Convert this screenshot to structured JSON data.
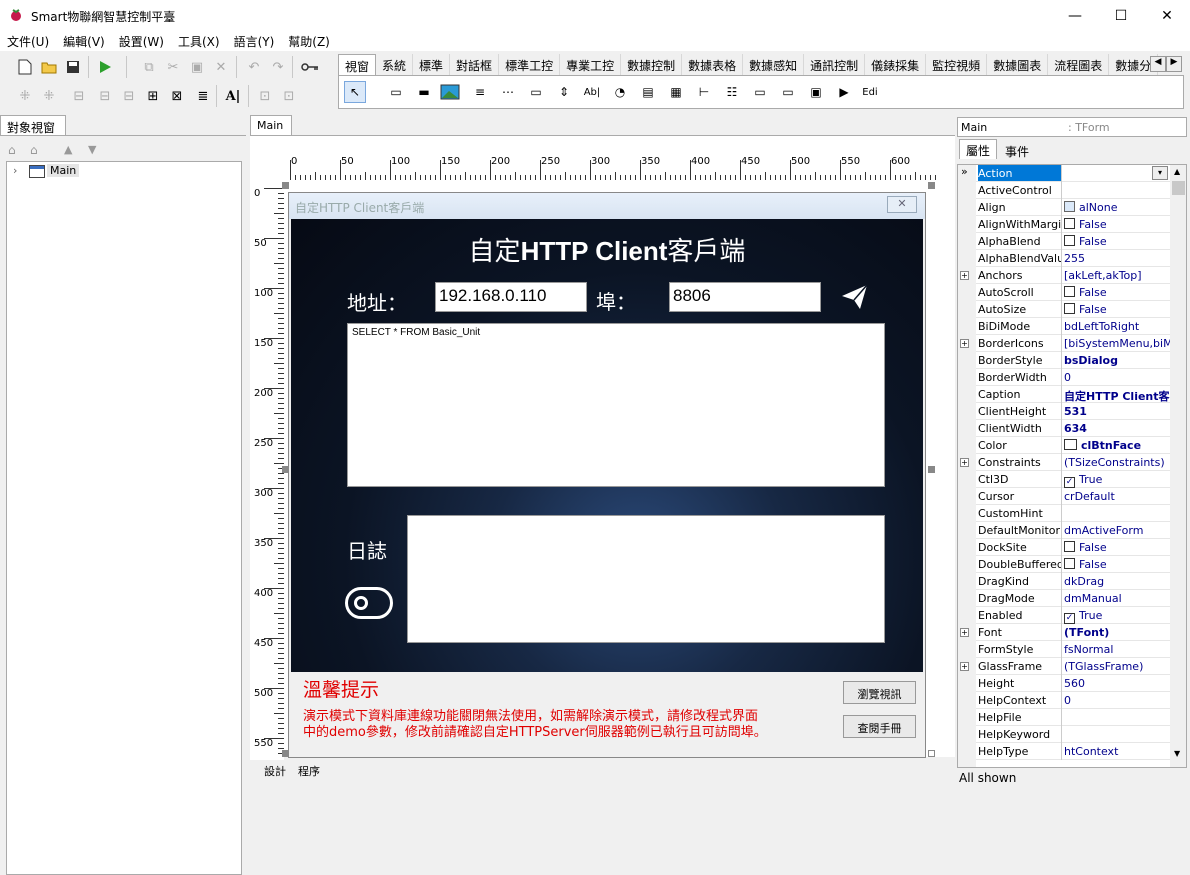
{
  "window": {
    "title": "Smart物聯網智慧控制平臺",
    "minimize": "—",
    "maximize": "☐",
    "close": "✕"
  },
  "menu": [
    "文件(U)",
    "編輯(V)",
    "設置(W)",
    "工具(X)",
    "語言(Y)",
    "幫助(Z)"
  ],
  "palette_tabs": [
    "視窗",
    "系統",
    "標準",
    "對話框",
    "標準工控",
    "專業工控",
    "數據控制",
    "數據表格",
    "數據感知",
    "通訊控制",
    "儀錶採集",
    "監控視頻",
    "數據圖表",
    "流程圖表",
    "數據分"
  ],
  "object_panel": {
    "title": "對象視窗",
    "tree_root": "Main"
  },
  "designer": {
    "tab": "Main",
    "bottom_tabs": [
      "設計",
      "程序"
    ],
    "hruler_labels": [
      "0",
      "50",
      "100",
      "150",
      "200",
      "250",
      "300",
      "350",
      "400",
      "450",
      "500",
      "550",
      "600"
    ],
    "vruler_labels": [
      "0",
      "50",
      "100",
      "150",
      "200",
      "250",
      "300",
      "350",
      "400",
      "450",
      "500",
      "550"
    ]
  },
  "form": {
    "window_title": "自定HTTP Client客戶端",
    "heading_prefix": "自定",
    "heading_bold": "HTTP Client",
    "heading_suffix": "客戶端",
    "address_label": "地址：",
    "address_value": "192.168.0.110",
    "port_label": "埠：",
    "port_value": "8806",
    "query_text": "SELECT * FROM Basic_Unit",
    "log_label": "日誌",
    "tip_title": "溫馨提示",
    "tip_line1": "演示模式下資料庫連線功能關閉無法使用，如需解除演示模式，請修改程式界面",
    "tip_line2": "中的demo參數，修改前請確認自定HTTPServer伺服器範例已執行且可訪問埠。",
    "browse_button": "瀏覽視訊",
    "manual_button": "查閱手冊"
  },
  "properties": {
    "object_name": "Main",
    "object_type": ": TForm",
    "tabs": [
      "屬性",
      "事件"
    ],
    "status": "All shown",
    "rows": [
      {
        "name": "Action",
        "value": "",
        "selected": true
      },
      {
        "name": "ActiveControl",
        "value": ""
      },
      {
        "name": "Align",
        "value": "alNone",
        "icon": "align"
      },
      {
        "name": "AlignWithMargins",
        "value": "False",
        "check": false
      },
      {
        "name": "AlphaBlend",
        "value": "False",
        "check": false
      },
      {
        "name": "AlphaBlendValue",
        "value": "255"
      },
      {
        "name": "Anchors",
        "value": "[akLeft,akTop]",
        "expand": true
      },
      {
        "name": "AutoScroll",
        "value": "False",
        "check": false
      },
      {
        "name": "AutoSize",
        "value": "False",
        "check": false
      },
      {
        "name": "BiDiMode",
        "value": "bdLeftToRight"
      },
      {
        "name": "BorderIcons",
        "value": "[biSystemMenu,biMini",
        "expand": true
      },
      {
        "name": "BorderStyle",
        "value": "bsDialog",
        "bold": true
      },
      {
        "name": "BorderWidth",
        "value": "0"
      },
      {
        "name": "Caption",
        "value": "自定HTTP Client客",
        "bold": true
      },
      {
        "name": "ClientHeight",
        "value": "531",
        "bold": true
      },
      {
        "name": "ClientWidth",
        "value": "634",
        "bold": true
      },
      {
        "name": "Color",
        "value": "clBtnFace",
        "bold": true,
        "swatch": true
      },
      {
        "name": "Constraints",
        "value": "(TSizeConstraints)",
        "expand": true
      },
      {
        "name": "Ctl3D",
        "value": "True",
        "check": true
      },
      {
        "name": "Cursor",
        "value": "crDefault"
      },
      {
        "name": "CustomHint",
        "value": ""
      },
      {
        "name": "DefaultMonitor",
        "value": "dmActiveForm"
      },
      {
        "name": "DockSite",
        "value": "False",
        "check": false
      },
      {
        "name": "DoubleBuffered",
        "value": "False",
        "check": false
      },
      {
        "name": "DragKind",
        "value": "dkDrag"
      },
      {
        "name": "DragMode",
        "value": "dmManual"
      },
      {
        "name": "Enabled",
        "value": "True",
        "check": true
      },
      {
        "name": "Font",
        "value": "(TFont)",
        "expand": true,
        "bold": true
      },
      {
        "name": "FormStyle",
        "value": "fsNormal"
      },
      {
        "name": "GlassFrame",
        "value": "(TGlassFrame)",
        "expand": true
      },
      {
        "name": "Height",
        "value": "560"
      },
      {
        "name": "HelpContext",
        "value": "0"
      },
      {
        "name": "HelpFile",
        "value": ""
      },
      {
        "name": "HelpKeyword",
        "value": ""
      },
      {
        "name": "HelpType",
        "value": "htContext"
      }
    ]
  }
}
